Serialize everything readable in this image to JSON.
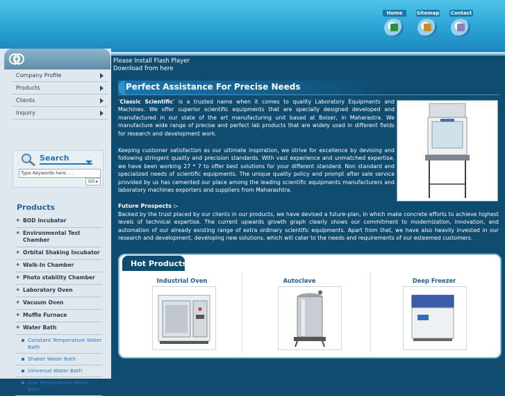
{
  "top_nav": [
    {
      "label": "Home",
      "icon": "home-icon"
    },
    {
      "label": "Sitemap",
      "icon": "sitemap-icon"
    },
    {
      "label": "Contact",
      "icon": "contact-icon"
    }
  ],
  "flash_notice": {
    "line1": "Please Install Flash Player",
    "line2": "Download from here"
  },
  "sidebar": {
    "menu": [
      "Company Profile",
      "Products",
      "Clients",
      "Inquiry"
    ],
    "search": {
      "title": "Search",
      "placeholder": "Type Keywords here. . .",
      "go_label": "GO"
    },
    "products_heading": "Products",
    "products": [
      {
        "label": "BOD Incubator",
        "type": "main"
      },
      {
        "label": "Environmental Test Chamber",
        "type": "main"
      },
      {
        "label": "Orbital Shaking Incubator",
        "type": "main"
      },
      {
        "label": "Walk-In Chamber",
        "type": "main"
      },
      {
        "label": "Photo stability Chamber",
        "type": "main"
      },
      {
        "label": "Laboratory Oven",
        "type": "main"
      },
      {
        "label": "Vacuum Oven",
        "type": "main"
      },
      {
        "label": "Muffle Furnace",
        "type": "main"
      },
      {
        "label": "Water Bath",
        "type": "main"
      },
      {
        "label": "Constant Temperature Water Bath",
        "type": "sub"
      },
      {
        "label": "Shaker Water Bath",
        "type": "sub"
      },
      {
        "label": "Universal Water Bath",
        "type": "sub"
      },
      {
        "label": "Low Temperature Water Bath",
        "type": "sub"
      }
    ]
  },
  "main": {
    "heading": "Perfect Assistance For Precise Needs",
    "intro_bold": "Classic Scientific",
    "intro_rest": " is a trusted name when it comes to quality Laboratory Equipments and Machines. We offer superior scientific equipments that are specially designed developed and manufactured in our state of the art manufacturing unit based at Boiser, in Maharastra. We manufacture wide range of precise and perfect lab products that are widely used in different fields for research and development work.",
    "paragraph2": "Keeping customer satisfaction as our ultimate inspiration, we strive for excellence by devising and following stringent quality and precision standards. With vast experience and unmatched expertise, we have been working 27 * 7 to offer best solutions for your different standard. Non standard and specialized needs of scientific equipments. The unique quality policy and prompt after sale service provided by us has cemented our place among the leading scientific equipments manufacturers and laboratory machines exporters and suppliers from Maharashtra.",
    "future_title": "Future Prospects :-",
    "future_text": "Backed by the trust placed by our clients in our products, we have devised a future-plan, in which make concrete efforts to achieve highest levels of technical expertise. The current upwards growth graph clearly shows our commitment to modernization, innovation, and automation of our already existing range of extra ordinary scientific equipments. Apart from that, we have also heavily invested in our research and development, developing new solutions, which will cater to the needs and requirements of our esteemed customers."
  },
  "hot_products": {
    "title": "Hot Products",
    "items": [
      "Industrial Oven",
      "Autoclave",
      "Deep Freezer"
    ]
  },
  "colors": {
    "page_bg": "#0f4c70",
    "top_band": "#2aa3d3",
    "accent_link": "#2d76c2"
  }
}
